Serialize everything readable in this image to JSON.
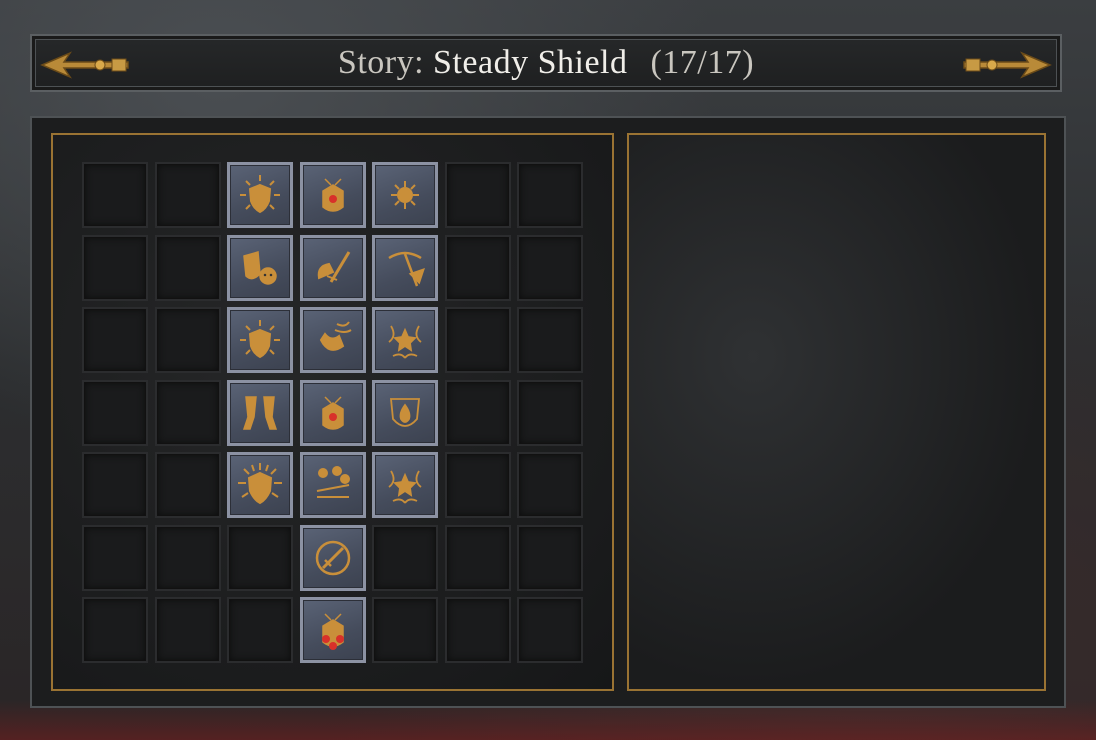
{
  "header": {
    "prefix": "Story:",
    "name": "Steady Shield",
    "count": "(17/17)",
    "left_arrow_icon": "arrow-left-icon",
    "right_arrow_icon": "arrow-right-icon"
  },
  "colors": {
    "accent_gold": "#9a7333",
    "tile_bg": "#4e5566",
    "tile_border": "#8c92a3",
    "icon_gold": "#c98f3a",
    "gem_red": "#d8312a"
  },
  "grid": {
    "columns": 7,
    "rows": 7,
    "filled": [
      {
        "row": 0,
        "col": 2,
        "icon": "radiant-shield-icon"
      },
      {
        "row": 0,
        "col": 3,
        "icon": "armor-gem-icon"
      },
      {
        "row": 0,
        "col": 4,
        "icon": "spiked-orb-icon"
      },
      {
        "row": 1,
        "col": 2,
        "icon": "shield-skull-icon"
      },
      {
        "row": 1,
        "col": 3,
        "icon": "axe-sword-icon"
      },
      {
        "row": 1,
        "col": 4,
        "icon": "pickaxe-icon"
      },
      {
        "row": 2,
        "col": 2,
        "icon": "radiant-shield-icon"
      },
      {
        "row": 2,
        "col": 3,
        "icon": "hunting-horn-icon"
      },
      {
        "row": 2,
        "col": 4,
        "icon": "thorn-star-icon"
      },
      {
        "row": 3,
        "col": 2,
        "icon": "greaves-icon"
      },
      {
        "row": 3,
        "col": 3,
        "icon": "armor-gem-icon"
      },
      {
        "row": 3,
        "col": 4,
        "icon": "flame-shield-icon"
      },
      {
        "row": 4,
        "col": 2,
        "icon": "bright-shield-icon"
      },
      {
        "row": 4,
        "col": 3,
        "icon": "scales-icon"
      },
      {
        "row": 4,
        "col": 4,
        "icon": "thorn-star-icon"
      },
      {
        "row": 5,
        "col": 3,
        "icon": "ring-blade-icon"
      },
      {
        "row": 6,
        "col": 3,
        "icon": "armor-triple-gem-icon"
      }
    ]
  }
}
